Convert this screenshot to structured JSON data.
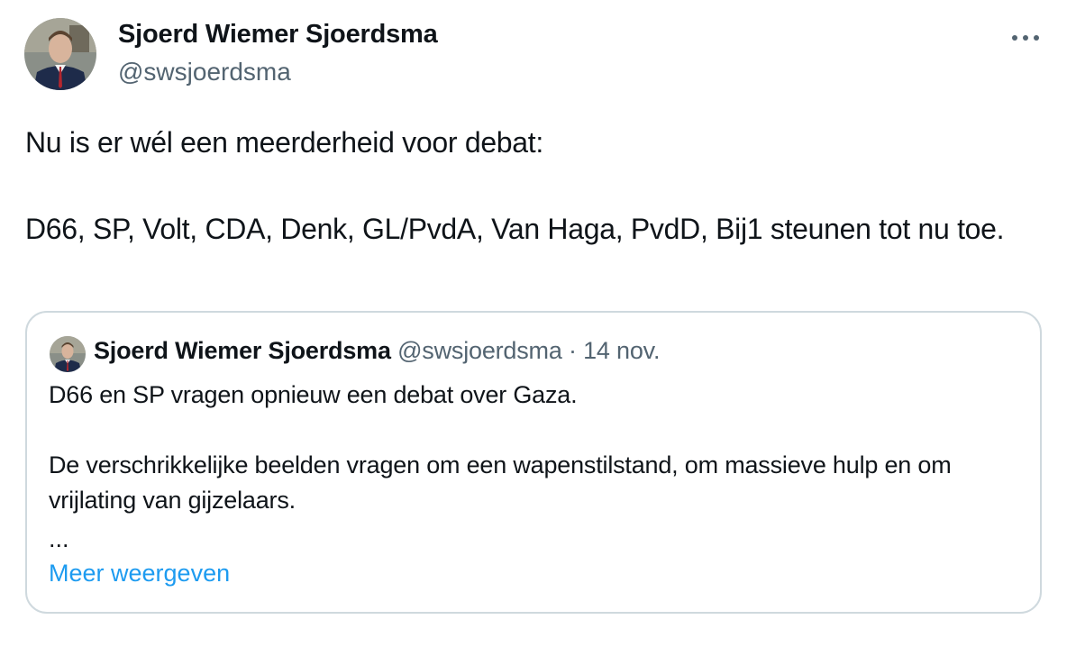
{
  "tweet": {
    "author_name": "Sjoerd Wiemer Sjoerdsma",
    "author_handle": "@swsjoerdsma",
    "more_icon": "more-horizontal-icon",
    "text": "Nu is er wél een meerderheid voor debat:\n\nD66, SP, Volt, CDA, Denk, GL/PvdA, Van Haga, PvdD, Bij1 steunen tot nu toe."
  },
  "quote": {
    "author_name": "Sjoerd Wiemer Sjoerdsma",
    "author_handle": "@swsjoerdsma",
    "separator": "·",
    "date": "14 nov.",
    "text": "D66 en SP vragen opnieuw een debat over Gaza.\n\nDe verschrikkelijke beelden vragen om een wapenstilstand, om massieve hulp en om vrijlating van gijzelaars.",
    "ellipsis": "...",
    "show_more_label": "Meer weergeven"
  },
  "colors": {
    "text_primary": "#0f1419",
    "text_secondary": "#536471",
    "link": "#1d9bf0",
    "border": "#cfd9de"
  }
}
